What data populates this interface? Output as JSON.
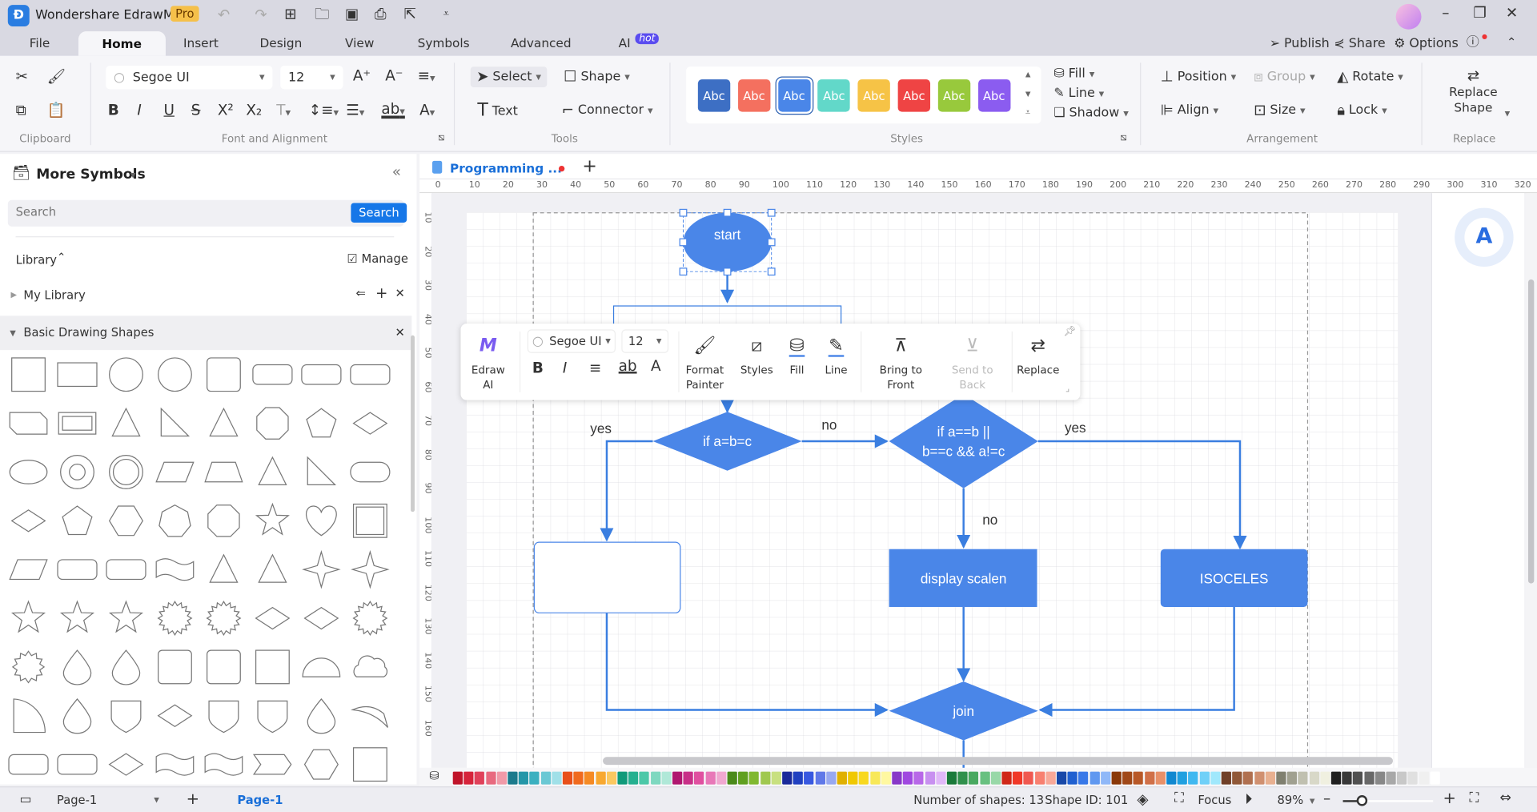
{
  "app": {
    "title": "Wondershare EdrawMax",
    "badge": "Pro"
  },
  "menu_tabs": [
    "File",
    "Home",
    "Insert",
    "Design",
    "View",
    "Symbols",
    "Advanced",
    "AI"
  ],
  "ai_badge": "hot",
  "top_actions": {
    "publish": "Publish",
    "share": "Share",
    "options": "Options"
  },
  "ribbon": {
    "clipboard_label": "Clipboard",
    "font": {
      "family": "Segoe UI",
      "size": "12",
      "label": "Font and Alignment"
    },
    "tools": {
      "select": "Select",
      "shape": "Shape",
      "text": "Text",
      "connector": "Connector",
      "label": "Tools"
    },
    "styles": {
      "swatch_text": "Abc",
      "swatches": [
        "#3d6fc4",
        "#f4705f",
        "#4a86e8",
        "#62d8c9",
        "#f6c346",
        "#ef4444",
        "#98c93c",
        "#8b5cf0"
      ],
      "selected": 2,
      "fill": "Fill",
      "line": "Line",
      "shadow": "Shadow",
      "label": "Styles"
    },
    "arrangement": {
      "position": "Position",
      "group": "Group",
      "rotate": "Rotate",
      "align": "Align",
      "size": "Size",
      "lock": "Lock",
      "label": "Arrangement"
    },
    "replace": {
      "button": "Replace Shape",
      "label": "Replace"
    }
  },
  "left_panel": {
    "title": "More Symbols",
    "search_placeholder": "Search",
    "search_button": "Search",
    "library": "Library",
    "manage": "Manage",
    "my_library": "My Library",
    "section": "Basic Drawing Shapes"
  },
  "doc_tab": {
    "name": "Programming ..."
  },
  "ruler": {
    "h": [
      "0",
      "10",
      "20",
      "30",
      "40",
      "50",
      "60",
      "70",
      "80",
      "90",
      "100",
      "110",
      "120",
      "130",
      "140",
      "150",
      "160",
      "170",
      "180",
      "190",
      "200",
      "210",
      "220",
      "230",
      "240",
      "250",
      "260",
      "270",
      "280",
      "290",
      "300",
      "310",
      "320"
    ],
    "v": [
      "10",
      "20",
      "30",
      "40",
      "50",
      "60",
      "70",
      "80",
      "90",
      "100",
      "110",
      "120",
      "130",
      "140",
      "150",
      "160"
    ]
  },
  "floating_toolbar": {
    "edraw_ai": "Edraw AI",
    "font": "Segoe UI",
    "size": "12",
    "format_painter": "Format Painter",
    "styles": "Styles",
    "fill": "Fill",
    "line": "Line",
    "bring_front": "Bring to Front",
    "send_back": "Send to Back",
    "replace": "Replace"
  },
  "diagram": {
    "start": "start",
    "decision1": "if a=b=c",
    "decision2_line1": "if a==b ||",
    "decision2_line2": "b==c && a!=c",
    "yes1": "yes",
    "no1": "no",
    "yes2": "yes",
    "no2": "no",
    "box1": "",
    "box2": "display scalen",
    "box3": "ISOCELES",
    "join": "join",
    "shape_color": "#4a86e8"
  },
  "palette": [
    "#c0142a",
    "#d6243b",
    "#e0415a",
    "#e86a7f",
    "#f09aa8",
    "#1b7a8c",
    "#2496a8",
    "#3bb0c0",
    "#6ac8d4",
    "#a0e0e8",
    "#e8501a",
    "#f06a1e",
    "#f58a24",
    "#f8a830",
    "#fbc860",
    "#0f9a7a",
    "#25b090",
    "#4cc8a8",
    "#7ed8c0",
    "#b0e8d8",
    "#b01870",
    "#c83088",
    "#e050a0",
    "#e878b8",
    "#f0a8d0",
    "#4a8a1a",
    "#60a020",
    "#80b830",
    "#a0c850",
    "#c8e080",
    "#1a2a9a",
    "#2040c0",
    "#3858e0",
    "#6078e8",
    "#98a8f0",
    "#e0b000",
    "#f0c800",
    "#f8d820",
    "#f8e858",
    "#fff8a0",
    "#8838c8",
    "#a048e0",
    "#b868e8",
    "#c890f0",
    "#e0b8f8",
    "#1a7a3a",
    "#30904c",
    "#48a860",
    "#68c080",
    "#98d8a8",
    "#d02818",
    "#f03828",
    "#f05850",
    "#f88070",
    "#f8a898",
    "#1848a8",
    "#2060d0",
    "#3878e8",
    "#6098f0",
    "#90b8f8",
    "#8a3808",
    "#a04818",
    "#b85828",
    "#d07048",
    "#e89068",
    "#1088d0",
    "#20a0e0",
    "#40b8f0",
    "#70d0f8",
    "#a0e8fc",
    "#704028",
    "#905838",
    "#b07050",
    "#d09070",
    "#e8b090",
    "#808070",
    "#a0a090",
    "#c0c0b0",
    "#d8d8c8",
    "#f0f0e0",
    "#202020",
    "#383838",
    "#505050",
    "#686868",
    "#888888",
    "#a8a8a8",
    "#c8c8c8",
    "#e0e0e0",
    "#f0f0f0",
    "#ffffff"
  ],
  "status": {
    "page_select": "Page-1",
    "page_tab": "Page-1",
    "shapes": "Number of shapes: 13",
    "shape_id": "Shape ID: 101",
    "focus": "Focus",
    "zoom": "89%",
    "zoom_level_percent": 89
  }
}
